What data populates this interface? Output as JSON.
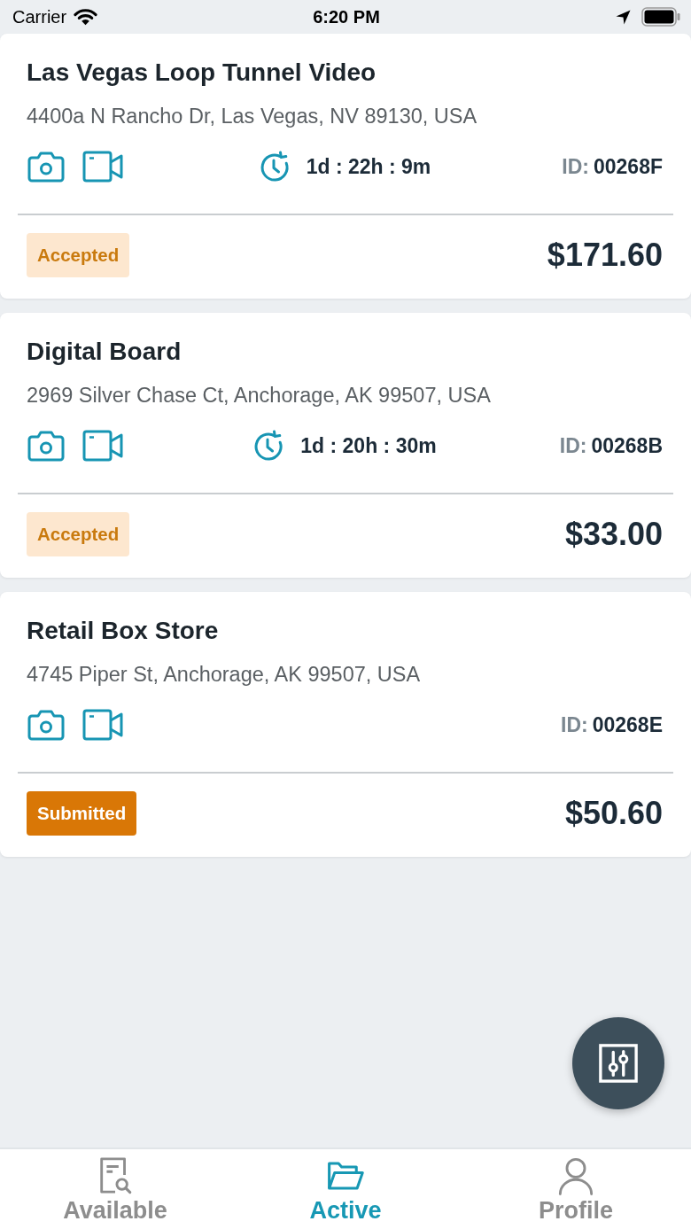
{
  "status_bar": {
    "carrier": "Carrier",
    "time": "6:20 PM"
  },
  "jobs": [
    {
      "title": "Las Vegas Loop Tunnel Video",
      "address": "4400a N Rancho Dr, Las Vegas, NV 89130, USA",
      "timer": "1d : 22h : 9m",
      "id_label": "ID:",
      "id_value": "00268F",
      "status": {
        "label": "Accepted",
        "kind": "accepted"
      },
      "price": "$171.60"
    },
    {
      "title": "Digital Board",
      "address": "2969 Silver Chase Ct, Anchorage, AK 99507, USA",
      "timer": "1d : 20h : 30m",
      "id_label": "ID:",
      "id_value": "00268B",
      "status": {
        "label": "Accepted",
        "kind": "accepted"
      },
      "price": "$33.00"
    },
    {
      "title": "Retail Box Store",
      "address": "4745 Piper St, Anchorage, AK 99507, USA",
      "id_label": "ID:",
      "id_value": "00268E",
      "status": {
        "label": "Submitted",
        "kind": "submitted"
      },
      "price": "$50.60"
    }
  ],
  "tabs": [
    {
      "label": "Available",
      "selected": false
    },
    {
      "label": "Active",
      "selected": true
    },
    {
      "label": "Profile",
      "selected": false
    }
  ]
}
